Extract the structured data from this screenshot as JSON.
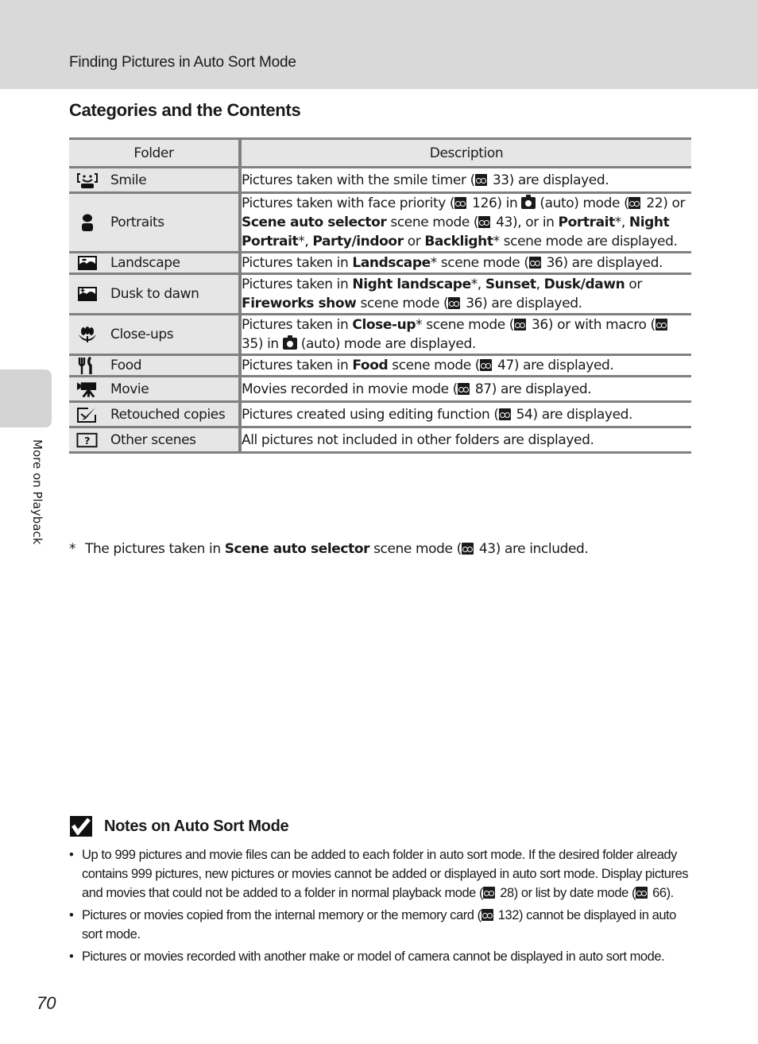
{
  "header": {
    "running_head": "Finding Pictures in Auto Sort Mode"
  },
  "section_title": "Categories and the Contents",
  "side_tab": {
    "label": "More on Playback"
  },
  "table": {
    "columns": [
      "Folder",
      "Description"
    ],
    "rows": [
      {
        "icon": "smile-icon",
        "folder": "Smile",
        "desc": [
          [
            "t",
            "Pictures taken with the smile timer ("
          ],
          [
            "ref",
            "33"
          ],
          [
            "t",
            ") are displayed."
          ]
        ]
      },
      {
        "icon": "portrait-icon",
        "folder": "Portraits",
        "desc": [
          [
            "t",
            "Pictures taken with face priority ("
          ],
          [
            "ref",
            "126"
          ],
          [
            "t",
            ") in "
          ],
          [
            "cam",
            ""
          ],
          [
            "t",
            " (auto) mode ("
          ],
          [
            "ref",
            "22"
          ],
          [
            "t",
            ") or "
          ],
          [
            "b",
            "Scene auto selector"
          ],
          [
            "t",
            " scene mode ("
          ],
          [
            "ref",
            "43"
          ],
          [
            "t",
            "), or in "
          ],
          [
            "b",
            "Portrait"
          ],
          [
            "t",
            "*, "
          ],
          [
            "b",
            "Night Portrait"
          ],
          [
            "t",
            "*, "
          ],
          [
            "b",
            "Party/indoor"
          ],
          [
            "t",
            " or "
          ],
          [
            "b",
            "Backlight"
          ],
          [
            "t",
            "* scene mode are displayed."
          ]
        ]
      },
      {
        "icon": "landscape-icon",
        "folder": "Landscape",
        "desc": [
          [
            "t",
            "Pictures taken in "
          ],
          [
            "b",
            "Landscape"
          ],
          [
            "t",
            "* scene mode ("
          ],
          [
            "ref",
            "36"
          ],
          [
            "t",
            ") are displayed."
          ]
        ]
      },
      {
        "icon": "dusk-to-dawn-icon",
        "folder": "Dusk to dawn",
        "desc": [
          [
            "t",
            "Pictures taken in "
          ],
          [
            "b",
            "Night landscape"
          ],
          [
            "t",
            "*, "
          ],
          [
            "b",
            "Sunset"
          ],
          [
            "t",
            ", "
          ],
          [
            "b",
            "Dusk/dawn"
          ],
          [
            "t",
            " or "
          ],
          [
            "b",
            "Fireworks show"
          ],
          [
            "t",
            " scene mode ("
          ],
          [
            "ref",
            "36"
          ],
          [
            "t",
            ") are displayed."
          ]
        ]
      },
      {
        "icon": "close-up-icon",
        "folder": "Close-ups",
        "desc": [
          [
            "t",
            "Pictures taken in "
          ],
          [
            "b",
            "Close-up"
          ],
          [
            "t",
            "* scene mode ("
          ],
          [
            "ref",
            "36"
          ],
          [
            "t",
            ") or with macro ("
          ],
          [
            "ref",
            "35"
          ],
          [
            "t",
            ") in "
          ],
          [
            "cam",
            ""
          ],
          [
            "t",
            " (auto) mode are displayed."
          ]
        ]
      },
      {
        "icon": "food-icon",
        "folder": "Food",
        "desc": [
          [
            "t",
            "Pictures taken in "
          ],
          [
            "b",
            "Food"
          ],
          [
            "t",
            " scene mode ("
          ],
          [
            "ref",
            "47"
          ],
          [
            "t",
            ") are displayed."
          ]
        ]
      },
      {
        "icon": "movie-icon",
        "folder": "Movie",
        "desc": [
          [
            "t",
            "Movies recorded in movie mode ("
          ],
          [
            "ref",
            "87"
          ],
          [
            "t",
            ") are displayed."
          ]
        ]
      },
      {
        "icon": "retouch-icon",
        "folder": "Retouched copies",
        "desc": [
          [
            "t",
            "Pictures created using editing function ("
          ],
          [
            "ref",
            "54"
          ],
          [
            "t",
            ") are displayed."
          ]
        ]
      },
      {
        "icon": "other-scenes-icon",
        "folder": "Other scenes",
        "desc": [
          [
            "t",
            "All pictures not included in other folders are displayed."
          ]
        ]
      }
    ]
  },
  "footnote": {
    "marker": "*",
    "parts": [
      [
        "t",
        "The pictures taken in "
      ],
      [
        "b",
        "Scene auto selector"
      ],
      [
        "t",
        " scene mode ("
      ],
      [
        "ref",
        "43"
      ],
      [
        "t",
        ") are included."
      ]
    ]
  },
  "notes": {
    "title": "Notes on Auto Sort Mode",
    "items": [
      [
        [
          "t",
          "Up to 999 pictures and movie files can be added to each folder in auto sort mode. If the desired folder already contains 999 pictures, new pictures or movies cannot be added or displayed in auto sort mode. Display pictures and movies that could not be added to a folder in normal playback mode ("
        ],
        [
          "ref",
          "28"
        ],
        [
          "t",
          ") or list by date mode ("
        ],
        [
          "ref",
          "66"
        ],
        [
          "t",
          ")."
        ]
      ],
      [
        [
          "t",
          "Pictures or movies copied from the internal memory or the memory card ("
        ],
        [
          "ref",
          "132"
        ],
        [
          "t",
          ") cannot be displayed in auto sort mode."
        ]
      ],
      [
        [
          "t",
          "Pictures or movies recorded with another make or model of camera cannot be displayed in auto sort mode."
        ]
      ]
    ]
  },
  "page_number": "70",
  "colors": {
    "header_band": "#d9d9d9",
    "table_rule": "#808080",
    "folder_cell": "#e6e6e6"
  }
}
